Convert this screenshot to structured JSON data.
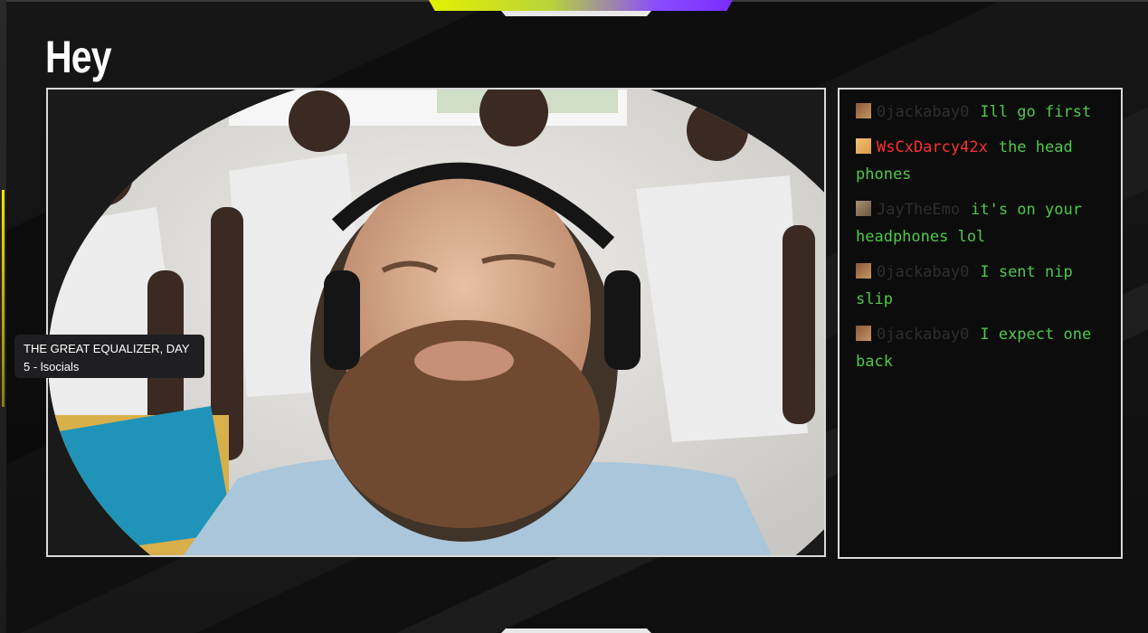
{
  "overlay": {
    "title": "Hey"
  },
  "tooltip": {
    "text": "THE GREAT EQUALIZER, DAY 5 - lsocials"
  },
  "chat": {
    "messages": [
      {
        "user": "0jackabay0",
        "text": "Ill go first",
        "user_style": "dim"
      },
      {
        "user": "WsCxDarcy42x",
        "text": "the head phones",
        "user_style": "red"
      },
      {
        "user": "JayTheEmo",
        "text": "it's on your headphones lol",
        "user_style": "dim"
      },
      {
        "user": "0jackabay0",
        "text": "I sent nip slip",
        "user_style": "dim"
      },
      {
        "user": "0jackabay0",
        "text": "I expect one back",
        "user_style": "dim"
      }
    ]
  },
  "colors": {
    "chat_text": "#4ec94a",
    "highlight_user": "#ff2f2f",
    "accent_yellow": "#e4f000",
    "accent_purple": "#7b2cff"
  }
}
